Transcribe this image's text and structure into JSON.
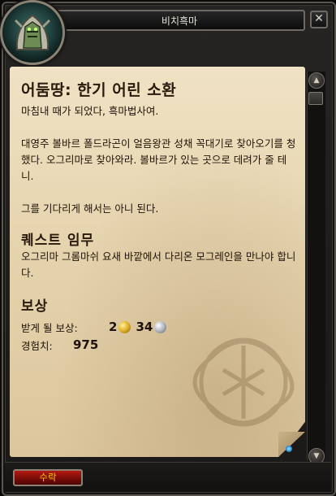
{
  "window": {
    "title": "비치흑마",
    "close_glyph": "✕"
  },
  "quest": {
    "title": "어둠땅: 한기 어린 소환",
    "description": [
      "마침내 때가 되었다, 흑마법사여.",
      "대영주 볼바르 폴드라곤이 얼음왕관 성채 꼭대기로 찾아오기를 청했다. 오그리마로 찾아와라. 볼바르가 있는 곳으로 데려가 줄 테니.",
      "그를 기다리게 해서는 아니 된다."
    ],
    "objectives_title": "퀘스트 임무",
    "objectives_text": "오그리마 그롬마쉬 요새 바깥에서 다리온 모그레인을 만나야 합니다.",
    "rewards_title": "보상",
    "reward_label": "받게 될 보상:",
    "gold": "2",
    "silver": "34",
    "xp_label": "경험치:",
    "xp_value": "975"
  },
  "buttons": {
    "accept": "수락"
  },
  "scroll": {
    "up_icon": "chevron-up-icon",
    "down_icon": "chevron-down-icon"
  },
  "colors": {
    "parchment": "#e6d4ae",
    "accept_text": "#f2c400",
    "accept_bg": "#8a0f08"
  }
}
